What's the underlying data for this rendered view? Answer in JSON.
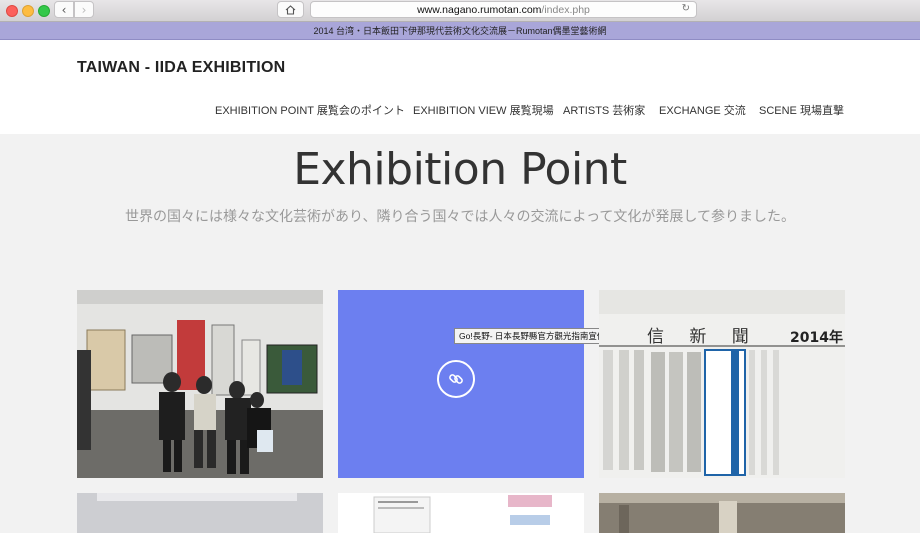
{
  "browser": {
    "url_host": "www.nagano.rumotan.com",
    "url_path": "/index.php",
    "tab_title": "2014 台湾・日本飯田下伊那現代芸術文化交流展－Rumotan偶墨堂藝術網"
  },
  "site": {
    "brand": "TAIWAN - IIDA EXHIBITION",
    "nav": [
      {
        "label": "EXHIBITION POINT 展覧会のポイント"
      },
      {
        "label": "EXHIBITION VIEW 展覧現場"
      },
      {
        "label": "ARTISTS 芸術家"
      },
      {
        "label": "EXCHANGE 交流"
      },
      {
        "label": "SCENE 現場直撃"
      }
    ]
  },
  "hero": {
    "title": "Exhibition Point",
    "subtitle": "世界の国々には様々な文化芸術があり、隣り合う国々では人々の交流によって文化が発展して参りました。"
  },
  "gallery": {
    "tooltip": "Go!長野- 日本長野縣官方觀光指南宣傳",
    "newspaper": {
      "date": "2014年",
      "name": "信 新 聞"
    }
  },
  "colors": {
    "tabstrip": "#a9a6d9",
    "overlay_blue": "#6c7ff0"
  }
}
